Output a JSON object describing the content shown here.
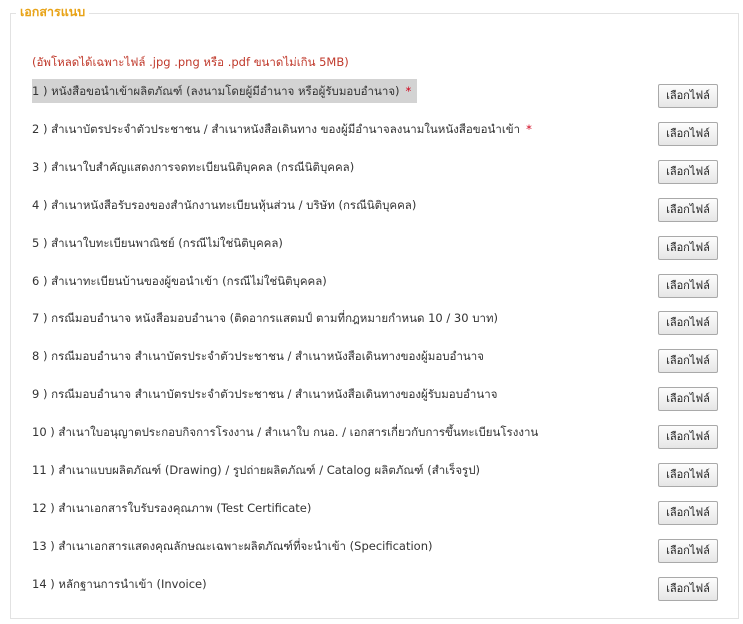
{
  "section": {
    "legend": "เอกสารแนบ",
    "notice": "(อัพโหลดได้เฉพาะไฟล์ .jpg .png หรือ .pdf ขนาดไม่เกิน 5MB)"
  },
  "button_label": "เลือกไฟล์",
  "required_mark": "*",
  "documents": [
    {
      "label": "1 ) หนังสือขอนำเข้าผลิตภัณฑ์ (ลงนามโดยผู้มีอำนาจ หรือผู้รับมอบอำนาจ)",
      "required": true,
      "highlighted": true
    },
    {
      "label": "2 ) สำเนาบัตรประจำตัวประชาชน / สำเนาหนังสือเดินทาง ของผู้มีอำนาจลงนามในหนังสือขอนำเข้า",
      "required": true,
      "highlighted": false
    },
    {
      "label": "3 ) สำเนาใบสำคัญแสดงการจดทะเบียนนิติบุคคล (กรณีนิติบุคคล)",
      "required": false,
      "highlighted": false
    },
    {
      "label": "4 ) สำเนาหนังสือรับรองของสำนักงานทะเบียนหุ้นส่วน / บริษัท (กรณีนิติบุคคล)",
      "required": false,
      "highlighted": false
    },
    {
      "label": "5 ) สำเนาใบทะเบียนพาณิชย์ (กรณีไม่ใช่นิติบุคคล)",
      "required": false,
      "highlighted": false
    },
    {
      "label": "6 ) สำเนาทะเบียนบ้านของผู้ขอนำเข้า (กรณีไม่ใช่นิติบุคคล)",
      "required": false,
      "highlighted": false
    },
    {
      "label": "7 ) กรณีมอบอำนาจ หนังสือมอบอำนาจ (ติดอากรแสตมป์ ตามที่กฎหมายกำหนด 10 / 30 บาท)",
      "required": false,
      "highlighted": false
    },
    {
      "label": "8 ) กรณีมอบอำนาจ สำเนาบัตรประจำตัวประชาชน / สำเนาหนังสือเดินทางของผู้มอบอำนาจ",
      "required": false,
      "highlighted": false
    },
    {
      "label": "9 ) กรณีมอบอำนาจ สำเนาบัตรประจำตัวประชาชน / สำเนาหนังสือเดินทางของผู้รับมอบอำนาจ",
      "required": false,
      "highlighted": false
    },
    {
      "label": "10 ) สำเนาใบอนุญาตประกอบกิจการโรงงาน / สำเนาใบ กนอ. / เอกสารเกี่ยวกับการขึ้นทะเบียนโรงงาน",
      "required": false,
      "highlighted": false
    },
    {
      "label": "11 ) สำเนาแบบผลิตภัณฑ์ (Drawing) / รูปถ่ายผลิตภัณฑ์ / Catalog ผลิตภัณฑ์ (สำเร็จรูป)",
      "required": false,
      "highlighted": false
    },
    {
      "label": "12 ) สำเนาเอกสารใบรับรองคุณภาพ (Test Certificate)",
      "required": false,
      "highlighted": false
    },
    {
      "label": "13 ) สำเนาเอกสารแสดงคุณลักษณะเฉพาะผลิตภัณฑ์ที่จะนำเข้า (Specification)",
      "required": false,
      "highlighted": false
    },
    {
      "label": "14 ) หลักฐานการนำเข้า (Invoice)",
      "required": false,
      "highlighted": false
    }
  ]
}
